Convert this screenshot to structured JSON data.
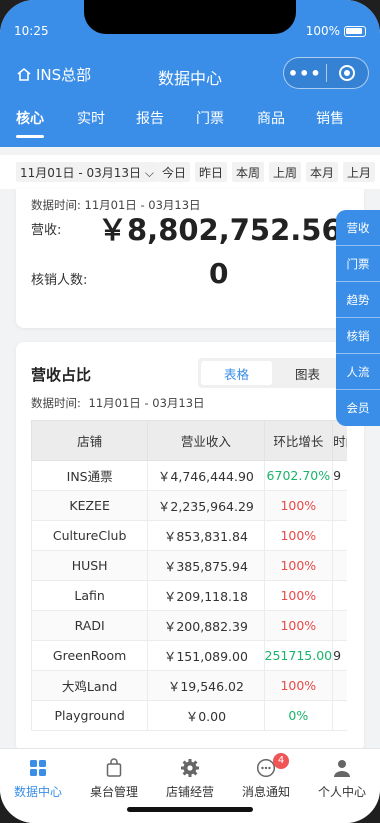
{
  "status_bar": {
    "time": "10:25",
    "battery": "100%"
  },
  "header": {
    "home_label": "INS总部",
    "title": "数据中心"
  },
  "tabs": [
    "核心",
    "实时",
    "报告",
    "门票",
    "商品",
    "销售"
  ],
  "date_filter": {
    "range": "11月01日 - 03月13日",
    "chips": [
      "今日",
      "昨日",
      "本周",
      "上周",
      "本月",
      "上月"
    ]
  },
  "summary": {
    "data_time_label": "数据时间:",
    "data_time": "11月01日 - 03月13日",
    "revenue_label": "营收:",
    "revenue_value": "￥8,802,752.56",
    "writeoff_label": "核销人数:",
    "writeoff_value": "0"
  },
  "side_nav": [
    "营收",
    "门票",
    "趋势",
    "核销",
    "人流",
    "会员"
  ],
  "revenue_share": {
    "title": "营收占比",
    "toggle": {
      "table": "表格",
      "chart": "图表"
    },
    "data_time_label": "数据时间:",
    "data_time": "11月01日 - 03月13日",
    "columns": [
      "店铺",
      "营业收入",
      "环比增长",
      "时间"
    ],
    "rows": [
      {
        "store": "INS通票",
        "revenue": "￥4,746,444.90",
        "growth": "6702.70%",
        "growth_color": "green",
        "extra": "9"
      },
      {
        "store": "KEZEE",
        "revenue": "￥2,235,964.29",
        "growth": "100%",
        "growth_color": "red",
        "extra": ""
      },
      {
        "store": "CultureClub",
        "revenue": "￥853,831.84",
        "growth": "100%",
        "growth_color": "red",
        "extra": ""
      },
      {
        "store": "HUSH",
        "revenue": "￥385,875.94",
        "growth": "100%",
        "growth_color": "red",
        "extra": ""
      },
      {
        "store": "Lafin",
        "revenue": "￥209,118.18",
        "growth": "100%",
        "growth_color": "red",
        "extra": ""
      },
      {
        "store": "RADI",
        "revenue": "￥200,882.39",
        "growth": "100%",
        "growth_color": "red",
        "extra": ""
      },
      {
        "store": "GreenRoom",
        "revenue": "￥151,089.00",
        "growth": "251715.00",
        "growth_color": "green",
        "extra": "9"
      },
      {
        "store": "大鸡Land",
        "revenue": "￥19,546.02",
        "growth": "100%",
        "growth_color": "red",
        "extra": ""
      },
      {
        "store": "Playground",
        "revenue": "￥0.00",
        "growth": "0%",
        "growth_color": "green",
        "extra": ""
      }
    ]
  },
  "tabbar": [
    {
      "label": "数据中心",
      "icon": "grid-icon",
      "active": true
    },
    {
      "label": "桌台管理",
      "icon": "bag-icon",
      "active": false
    },
    {
      "label": "店铺经营",
      "icon": "gear-icon",
      "active": false
    },
    {
      "label": "消息通知",
      "icon": "message-icon",
      "active": false,
      "badge": "4"
    },
    {
      "label": "个人中心",
      "icon": "person-icon",
      "active": false
    }
  ],
  "colors": {
    "primary": "#3a8ee8",
    "positive": "#19b46a",
    "negative": "#e84a4a",
    "badge": "#f05454"
  }
}
